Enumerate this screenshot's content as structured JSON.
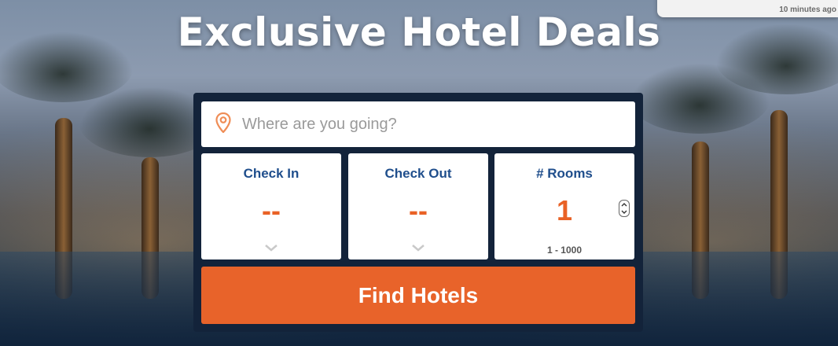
{
  "toast": {
    "time": "10 minutes ago"
  },
  "headline": "Exclusive Hotel Deals",
  "search": {
    "placeholder": "Where are you going?",
    "check_in": {
      "label": "Check In",
      "value": "--"
    },
    "check_out": {
      "label": "Check Out",
      "value": "--"
    },
    "rooms": {
      "label": "# Rooms",
      "value": "1",
      "range": "1 - 1000"
    },
    "button": "Find Hotels"
  },
  "colors": {
    "accent": "#e8632a",
    "label": "#1f4e8c",
    "panel": "#13233a"
  },
  "icons": [
    "location-pin-icon",
    "chevron-down-icon",
    "stepper-icon"
  ]
}
